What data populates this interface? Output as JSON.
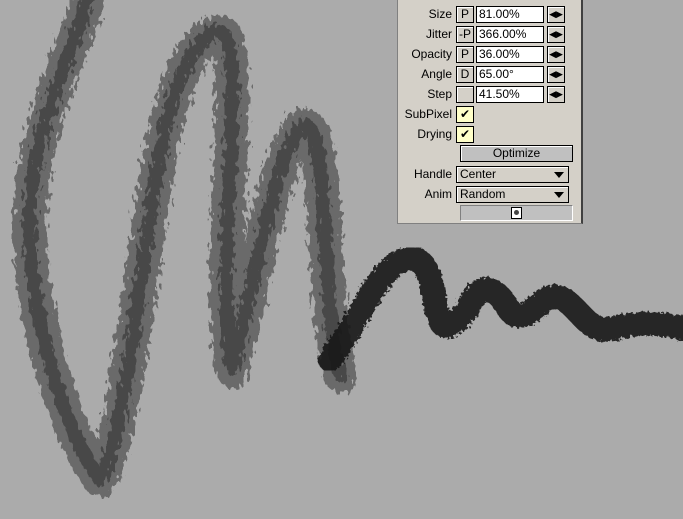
{
  "brush_panel": {
    "params": [
      {
        "label": "Size",
        "modifier": "P",
        "value": "81.00%"
      },
      {
        "label": "Jitter",
        "modifier": "-P",
        "value": "366.00%"
      },
      {
        "label": "Opacity",
        "modifier": "P",
        "value": "36.00%"
      },
      {
        "label": "Angle",
        "modifier": "D",
        "value": "65.00°"
      },
      {
        "label": "Step",
        "modifier": "",
        "value": "41.50%"
      }
    ],
    "subpixel": {
      "label": "SubPixel",
      "checked": true,
      "mark": "✔"
    },
    "drying": {
      "label": "Drying",
      "checked": true,
      "mark": "✔"
    },
    "optimize_label": "Optimize",
    "handle": {
      "label": "Handle",
      "value": "Center"
    },
    "anim": {
      "label": "Anim",
      "value": "Random"
    },
    "slider_value": 0.5
  },
  "spin_icon": "◀▶",
  "colors": {
    "canvas": "#ababab",
    "panel": "#d4d0c8",
    "stroke": "#222222",
    "checkbox": "#ffffc8"
  }
}
